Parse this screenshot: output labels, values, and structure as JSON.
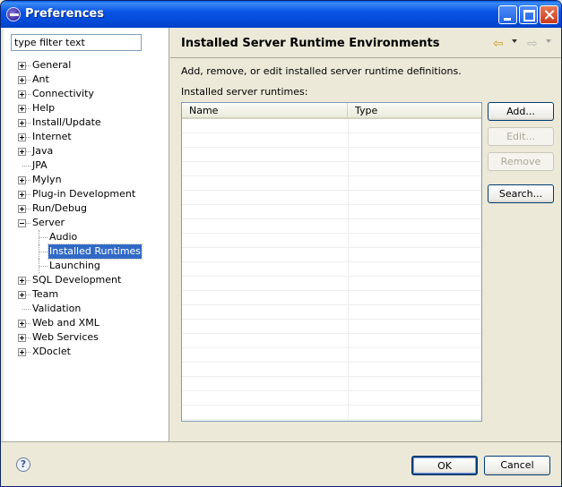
{
  "window": {
    "title": "Preferences"
  },
  "filter": {
    "value": "type filter text"
  },
  "tree": {
    "items": [
      {
        "label": "General",
        "expander": "plus"
      },
      {
        "label": "Ant",
        "expander": "plus"
      },
      {
        "label": "Connectivity",
        "expander": "plus"
      },
      {
        "label": "Help",
        "expander": "plus"
      },
      {
        "label": "Install/Update",
        "expander": "plus"
      },
      {
        "label": "Internet",
        "expander": "plus"
      },
      {
        "label": "Java",
        "expander": "plus"
      },
      {
        "label": "JPA",
        "expander": "none"
      },
      {
        "label": "Mylyn",
        "expander": "plus"
      },
      {
        "label": "Plug-in Development",
        "expander": "plus"
      },
      {
        "label": "Run/Debug",
        "expander": "plus"
      },
      {
        "label": "Server",
        "expander": "minus"
      },
      {
        "label": "Audio",
        "child": true
      },
      {
        "label": "Installed Runtimes",
        "child": true,
        "selected": true
      },
      {
        "label": "Launching",
        "child": true
      },
      {
        "label": "SQL Development",
        "expander": "plus"
      },
      {
        "label": "Team",
        "expander": "plus"
      },
      {
        "label": "Validation",
        "expander": "none"
      },
      {
        "label": "Web and XML",
        "expander": "plus"
      },
      {
        "label": "Web Services",
        "expander": "plus"
      },
      {
        "label": "XDoclet",
        "expander": "plus"
      }
    ]
  },
  "page": {
    "title": "Installed Server Runtime Environments",
    "description": "Add, remove, or edit installed server runtime definitions.",
    "table_label": "Installed server runtimes:",
    "columns": [
      "Name",
      "Type"
    ]
  },
  "buttons": {
    "add": "Add...",
    "edit": "Edit...",
    "remove": "Remove",
    "search": "Search...",
    "ok": "OK",
    "cancel": "Cancel"
  },
  "icons": {
    "back": "back-arrow-icon",
    "forward": "forward-arrow-icon",
    "help": "help-icon"
  },
  "colors": {
    "titlebar": "#0a54e6",
    "selection": "#316ac5",
    "dialog_bg": "#ece9d8"
  }
}
